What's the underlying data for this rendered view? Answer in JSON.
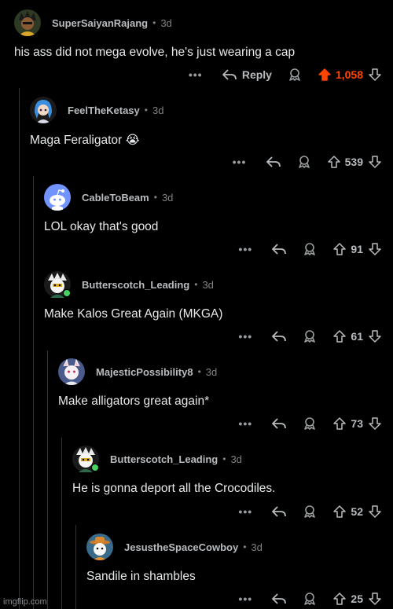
{
  "colors": {
    "background": "#000000",
    "upvoted": "#ff4500",
    "online": "#46d160"
  },
  "comments": [
    {
      "username": "SuperSaiyanRajang",
      "sep": "•",
      "time": "3d",
      "text": "his ass did not mega evolve, he's just wearing a cap",
      "score": "1,058",
      "more": "•••",
      "reply_label": "Reply",
      "upvoted": true,
      "avatar_icon": "saiyan-avatar-icon"
    },
    {
      "username": "FeelTheKetasy",
      "sep": "•",
      "time": "3d",
      "text": "Maga Feraligator 😭",
      "score": "539",
      "more": "•••",
      "avatar_icon": "blue-hair-avatar-icon"
    },
    {
      "username": "CableToBeam",
      "sep": "•",
      "time": "3d",
      "text": "LOL okay that's good",
      "score": "91",
      "more": "•••",
      "avatar_icon": "default-snoo-avatar-icon"
    },
    {
      "username": "Butterscotch_Leading",
      "sep": "•",
      "time": "3d",
      "text": "Make Kalos Great Again (MKGA)",
      "score": "61",
      "more": "•••",
      "avatar_icon": "butterscotch-avatar-icon",
      "online": true
    },
    {
      "username": "MajesticPossibility8",
      "sep": "•",
      "time": "3d",
      "text": "Make alligators great again*",
      "score": "73",
      "more": "•••",
      "avatar_icon": "majestic-avatar-icon"
    },
    {
      "username": "Butterscotch_Leading",
      "sep": "•",
      "time": "3d",
      "text": "He is gonna deport all the Crocodiles.",
      "score": "52",
      "more": "•••",
      "avatar_icon": "butterscotch-avatar-icon",
      "online": true
    },
    {
      "username": "JesustheSpaceCowboy",
      "sep": "•",
      "time": "3d",
      "text": "Sandile in shambles",
      "score": "25",
      "more": "•••",
      "avatar_icon": "cowboy-avatar-icon"
    }
  ],
  "watermark": "imgflip.com"
}
